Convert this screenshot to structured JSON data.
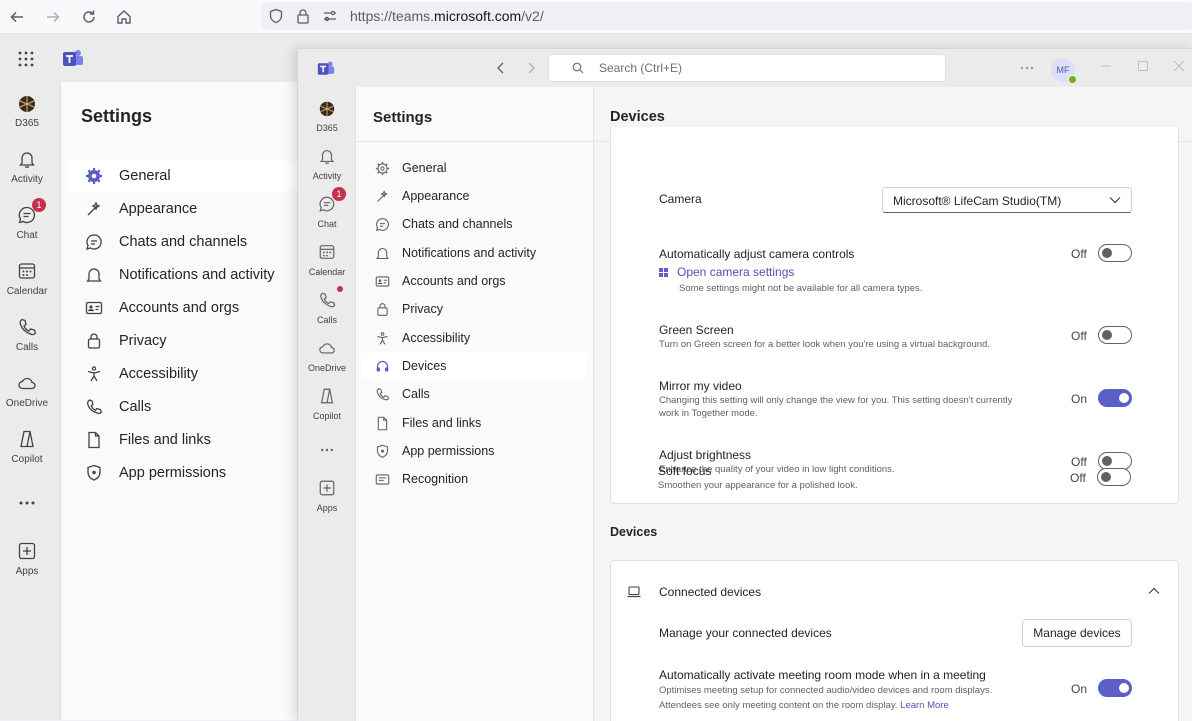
{
  "browser": {
    "url_prefix": "https://teams.",
    "url_domain": "microsoft.com",
    "url_suffix": "/v2/"
  },
  "bg": {
    "rail": [
      {
        "label": "D365",
        "icon": "d365-icon"
      },
      {
        "label": "Activity",
        "icon": "bell-icon"
      },
      {
        "label": "Chat",
        "icon": "chat-icon",
        "badge": "1"
      },
      {
        "label": "Calendar",
        "icon": "calendar-icon"
      },
      {
        "label": "Calls",
        "icon": "phone-icon"
      },
      {
        "label": "OneDrive",
        "icon": "cloud-icon"
      },
      {
        "label": "Copilot",
        "icon": "copilot-icon"
      },
      {
        "label": "",
        "icon": "more-icon"
      },
      {
        "label": "Apps",
        "icon": "add-app-icon"
      }
    ],
    "title": "Settings",
    "nav": [
      "General",
      "Appearance",
      "Chats and channels",
      "Notifications and activity",
      "Accounts and orgs",
      "Privacy",
      "Accessibility",
      "Calls",
      "Files and links",
      "App permissions"
    ]
  },
  "win": {
    "search_placeholder": "Search (Ctrl+E)",
    "avatar": "MF",
    "rail": [
      {
        "label": "D365"
      },
      {
        "label": "Activity"
      },
      {
        "label": "Chat",
        "badge": "1"
      },
      {
        "label": "Calendar"
      },
      {
        "label": "Calls"
      },
      {
        "label": "OneDrive"
      },
      {
        "label": "Copilot"
      },
      {
        "label": ""
      },
      {
        "label": "Apps"
      }
    ],
    "nav_title": "Settings",
    "nav": [
      "General",
      "Appearance",
      "Chats and channels",
      "Notifications and activity",
      "Accounts and orgs",
      "Privacy",
      "Accessibility",
      "Devices",
      "Calls",
      "Files and links",
      "App permissions",
      "Recognition"
    ],
    "selected_nav": "Devices"
  },
  "main": {
    "title": "Devices",
    "camera_label": "Camera",
    "camera_value": "Microsoft® LifeCam Studio(TM)",
    "auto_adjust": {
      "label": "Automatically adjust camera controls",
      "state": "Off",
      "link": "Open camera settings",
      "sub": "Some settings might not be available for all camera types."
    },
    "green_screen": {
      "label": "Green Screen",
      "sub": "Turn on Green screen for a better look when you're using a virtual background.",
      "state": "Off"
    },
    "mirror": {
      "label": "Mirror my video",
      "sub1": "Changing this setting will only change the view for you. This setting doesn't currently",
      "sub2": "work in Together mode.",
      "state": "On"
    },
    "brightness": {
      "label": "Adjust brightness",
      "sub": "Enhance the quality of your video in low light conditions.",
      "state": "Off"
    },
    "soft_focus": {
      "label": "Soft focus",
      "sub": "Smoothen your appearance for a polished look.",
      "state": "Off"
    },
    "devices_heading": "Devices",
    "connected": {
      "label": "Connected devices",
      "manage_label": "Manage your connected devices",
      "manage_button": "Manage devices",
      "room_mode_label": "Automatically activate meeting room mode when in a meeting",
      "room_mode_sub1": "Optimises meeting setup for connected audio/video devices and room displays.",
      "room_mode_sub2": "Attendees see only meeting content on the room display.",
      "learn_more": "Learn More",
      "room_mode_state": "On"
    }
  },
  "colors": {
    "accent": "#5b5fc7",
    "badge": "#c4314b",
    "presence": "#6bb700"
  }
}
